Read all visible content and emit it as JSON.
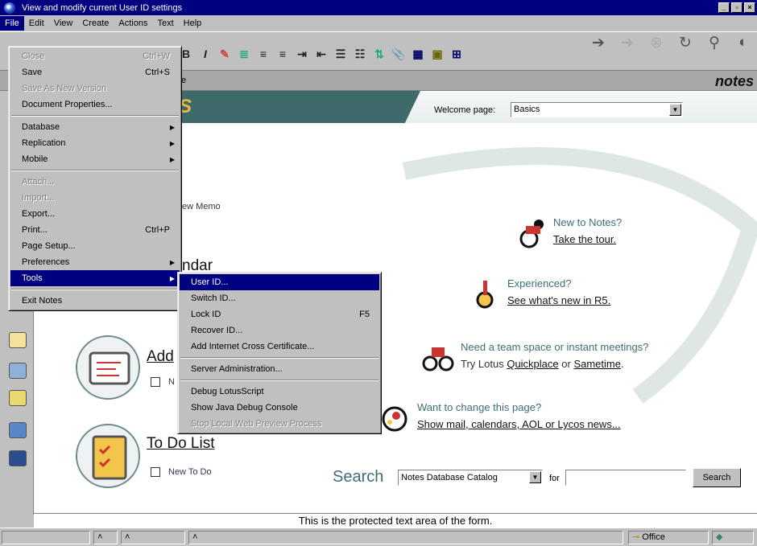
{
  "window": {
    "title": "View and modify current User ID settings"
  },
  "menubar": [
    "File",
    "Edit",
    "View",
    "Create",
    "Actions",
    "Text",
    "Help"
  ],
  "file_menu": {
    "items": [
      {
        "label": "Close",
        "shortcut": "Ctrl+W",
        "disabled": true
      },
      {
        "label": "Save",
        "shortcut": "Ctrl+S",
        "disabled": false
      },
      {
        "label": "Save As New Version",
        "shortcut": "",
        "disabled": true
      },
      {
        "label": "Document Properties...",
        "shortcut": "",
        "disabled": false
      },
      {
        "label": "Database",
        "shortcut": "",
        "disabled": false,
        "submenu": true
      },
      {
        "label": "Replication",
        "shortcut": "",
        "disabled": false,
        "submenu": true
      },
      {
        "label": "Mobile",
        "shortcut": "",
        "disabled": false,
        "submenu": true
      },
      {
        "label": "Attach...",
        "shortcut": "",
        "disabled": true
      },
      {
        "label": "Import...",
        "shortcut": "",
        "disabled": true
      },
      {
        "label": "Export...",
        "shortcut": "",
        "disabled": false
      },
      {
        "label": "Print...",
        "shortcut": "Ctrl+P",
        "disabled": false
      },
      {
        "label": "Page Setup...",
        "shortcut": "",
        "disabled": false
      },
      {
        "label": "Preferences",
        "shortcut": "",
        "disabled": false,
        "submenu": true
      },
      {
        "label": "Tools",
        "shortcut": "",
        "disabled": false,
        "submenu": true,
        "highlighted": true
      },
      {
        "label": "Exit Notes",
        "shortcut": "",
        "disabled": false
      }
    ]
  },
  "tools_menu": {
    "items": [
      {
        "label": "User ID...",
        "shortcut": "",
        "disabled": false,
        "highlighted": true
      },
      {
        "label": "Switch ID...",
        "shortcut": "",
        "disabled": false
      },
      {
        "label": "Lock ID",
        "shortcut": "F5",
        "disabled": false
      },
      {
        "label": "Recover ID...",
        "shortcut": "",
        "disabled": false
      },
      {
        "label": "Add Internet Cross Certificate...",
        "shortcut": "",
        "disabled": false
      },
      {
        "label": "Server Administration...",
        "shortcut": "",
        "disabled": false
      },
      {
        "label": "Debug LotusScript",
        "shortcut": "",
        "disabled": false
      },
      {
        "label": "Show Java Debug Console",
        "shortcut": "",
        "disabled": false
      },
      {
        "label": "Stop Local Web Preview Process",
        "shortcut": "",
        "disabled": true
      }
    ]
  },
  "tab_fragment": "e",
  "brand": "notes",
  "welcome": {
    "label": "Welcome page:",
    "selected": "Basics"
  },
  "fragments": {
    "memo": "ew Memo",
    "calendar": "ndar"
  },
  "promos": {
    "new_to_notes": {
      "heading": "New to Notes?",
      "link": "Take the tour."
    },
    "experienced": {
      "heading": "Experienced?",
      "link": "See what's new in R5."
    },
    "team": {
      "heading": "Need a team space or instant meetings?",
      "prefix": "Try Lotus ",
      "link1": "Quickplace",
      "middle": " or ",
      "link2": "Sametime",
      "suffix": "."
    },
    "change": {
      "heading": "Want to change this page?",
      "link": "Show mail, calendars, AOL or Lycos news..."
    }
  },
  "sections": {
    "address": {
      "title": "Add",
      "action": "N"
    },
    "todo": {
      "title": "To Do List",
      "action": "New To Do"
    }
  },
  "search": {
    "label": "Search",
    "scope": "Notes Database Catalog",
    "for": "for",
    "value": "",
    "button": "Search"
  },
  "protected_text": "This is the protected text area of the form.",
  "status": {
    "location": "Office"
  }
}
